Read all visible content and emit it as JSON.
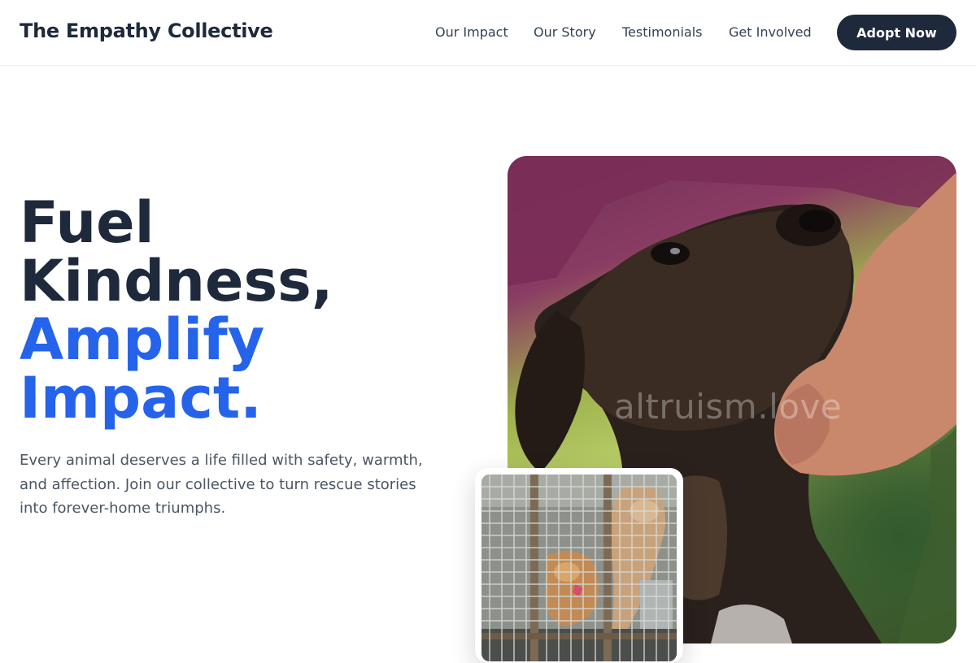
{
  "header": {
    "brand": "The Empathy Collective",
    "nav": [
      "Our Impact",
      "Our Story",
      "Testimonials",
      "Get Involved"
    ],
    "cta_label": "Adopt Now"
  },
  "hero": {
    "headline_dark_1": "Fuel",
    "headline_dark_2": "Kindness,",
    "headline_blue_1": "Amplify",
    "headline_blue_2": "Impact.",
    "subtext": "Every animal deserves a life filled with safety, warmth, and affection. Join our collective to turn rescue stories into forever-home triumphs.",
    "watermark": "altruism.love"
  },
  "colors": {
    "text_dark": "#1e293b",
    "accent_blue": "#2563eb",
    "body_gray": "#4b5563"
  }
}
